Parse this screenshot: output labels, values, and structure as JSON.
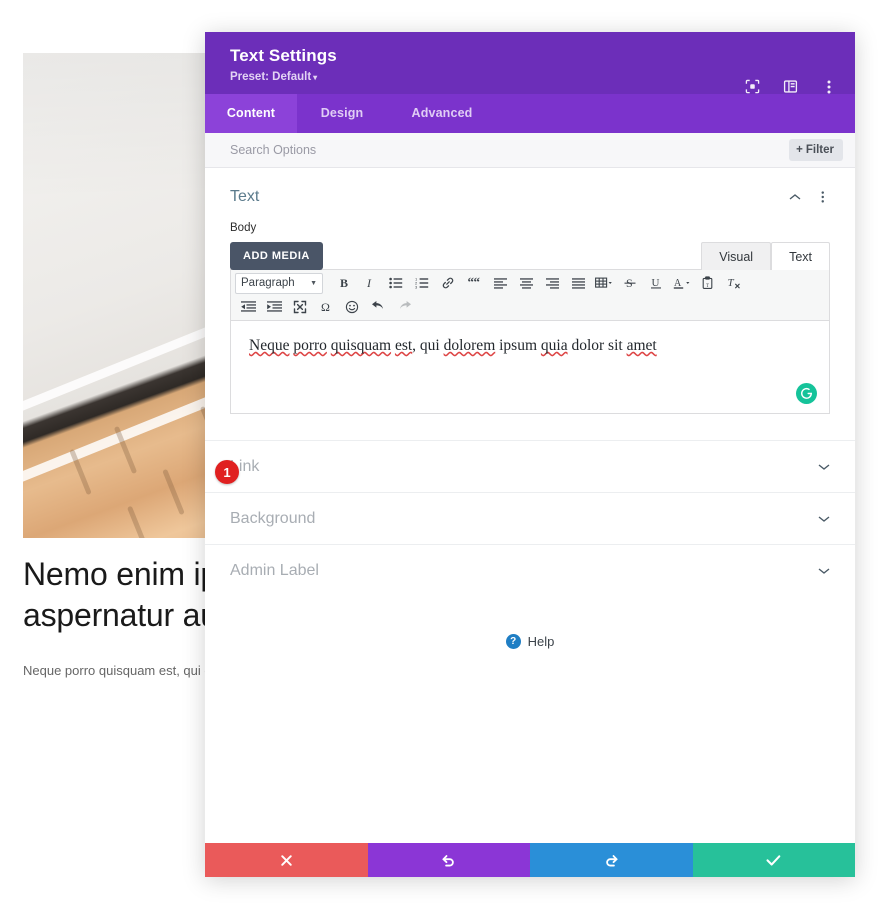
{
  "background_page": {
    "hero_image_alt": "white-fabric-and-wooden-slats-photo",
    "heading": "Nemo enim ipsum aspernatur aut",
    "paragraph": "Neque porro quisquam est, qui d"
  },
  "modal": {
    "title": "Text Settings",
    "preset_label": "Preset: Default",
    "preset_caret": "▾",
    "header_icons": [
      {
        "name": "focus-mode-icon"
      },
      {
        "name": "layout-panel-icon"
      },
      {
        "name": "more-vertical-icon"
      }
    ],
    "tabs": [
      {
        "label": "Content",
        "active": true
      },
      {
        "label": "Design",
        "active": false
      },
      {
        "label": "Advanced",
        "active": false
      }
    ],
    "search": {
      "placeholder": "Search Options",
      "value": ""
    },
    "filter_button": {
      "plus": "+",
      "label": "Filter"
    },
    "sections": {
      "text": {
        "title": "Text",
        "field_label": "Body",
        "add_media_label": "ADD MEDIA",
        "editor_tabs": [
          {
            "label": "Visual",
            "active": false
          },
          {
            "label": "Text",
            "active": true
          }
        ],
        "toolbar": {
          "format_select": "Paragraph",
          "row1": [
            "bold-icon",
            "italic-icon",
            "bulleted-list-icon",
            "numbered-list-icon",
            "link-icon",
            "blockquote-icon",
            "align-left-icon",
            "align-center-icon",
            "align-right-icon",
            "align-justify-icon",
            "table-icon",
            "strikethrough-icon",
            "underline-icon",
            "text-color-icon",
            "paste-as-text-icon",
            "clear-formatting-icon"
          ],
          "row2": [
            "outdent-icon",
            "indent-icon",
            "fullscreen-icon",
            "special-character-icon",
            "emoji-icon",
            "undo-icon",
            "redo-icon"
          ]
        },
        "body_text": {
          "full": "Neque porro quisquam est, qui dolorem ipsum quia dolor sit amet",
          "parts": [
            {
              "t": "Neque",
              "spell": true
            },
            {
              "t": " ",
              "spell": false
            },
            {
              "t": "porro",
              "spell": true
            },
            {
              "t": " ",
              "spell": false
            },
            {
              "t": "quisquam",
              "spell": true
            },
            {
              "t": " ",
              "spell": false
            },
            {
              "t": "est",
              "spell": true
            },
            {
              "t": ", qui ",
              "spell": false
            },
            {
              "t": "dolorem",
              "spell": true
            },
            {
              "t": " ipsum ",
              "spell": false
            },
            {
              "t": "quia",
              "spell": true
            },
            {
              "t": " dolor sit ",
              "spell": false
            },
            {
              "t": "amet",
              "spell": true
            }
          ]
        },
        "grammarly_icon": "grammarly-logo-icon",
        "step_badge": "1"
      },
      "collapsed": [
        {
          "title": "Link"
        },
        {
          "title": "Background"
        },
        {
          "title": "Admin Label"
        }
      ]
    },
    "help": {
      "mark": "?",
      "label": "Help"
    },
    "footer_buttons": [
      {
        "name": "cancel-button",
        "icon": "close-icon",
        "color": "#ea5a5a"
      },
      {
        "name": "undo-button",
        "icon": "undo-icon",
        "color": "#8b36d6"
      },
      {
        "name": "redo-button",
        "icon": "redo-icon",
        "color": "#2a8fd8"
      },
      {
        "name": "save-button",
        "icon": "check-icon",
        "color": "#27c19a"
      }
    ]
  },
  "colors": {
    "header_purple": "#6c2eb9",
    "tabbar_purple": "#7b33cc",
    "tab_active_purple": "#8c42d9",
    "section_title": "#5b7b8c",
    "badge_red": "#e02020",
    "grammarly_green": "#15c39a"
  }
}
